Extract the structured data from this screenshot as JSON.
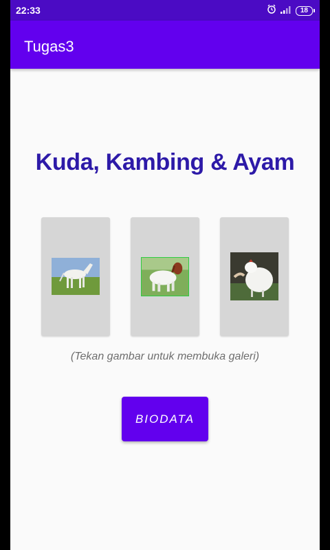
{
  "status_bar": {
    "time": "22:33",
    "battery": "18",
    "icons": [
      "alarm-icon",
      "signal-icon",
      "battery-icon"
    ]
  },
  "app_bar": {
    "title": "Tugas3"
  },
  "main": {
    "heading": "Kuda, Kambing & Ayam",
    "gallery": [
      {
        "name": "horse",
        "icon": "horse-photo"
      },
      {
        "name": "goat",
        "icon": "goat-photo"
      },
      {
        "name": "chicken",
        "icon": "chicken-photo"
      }
    ],
    "hint": "(Tekan gambar untuk membuka galeri)",
    "button_label": "BIODATA"
  },
  "colors": {
    "status_bar": "#4b0bc4",
    "primary": "#6200ee",
    "heading": "#2d1aa8",
    "background": "#fafafa"
  }
}
